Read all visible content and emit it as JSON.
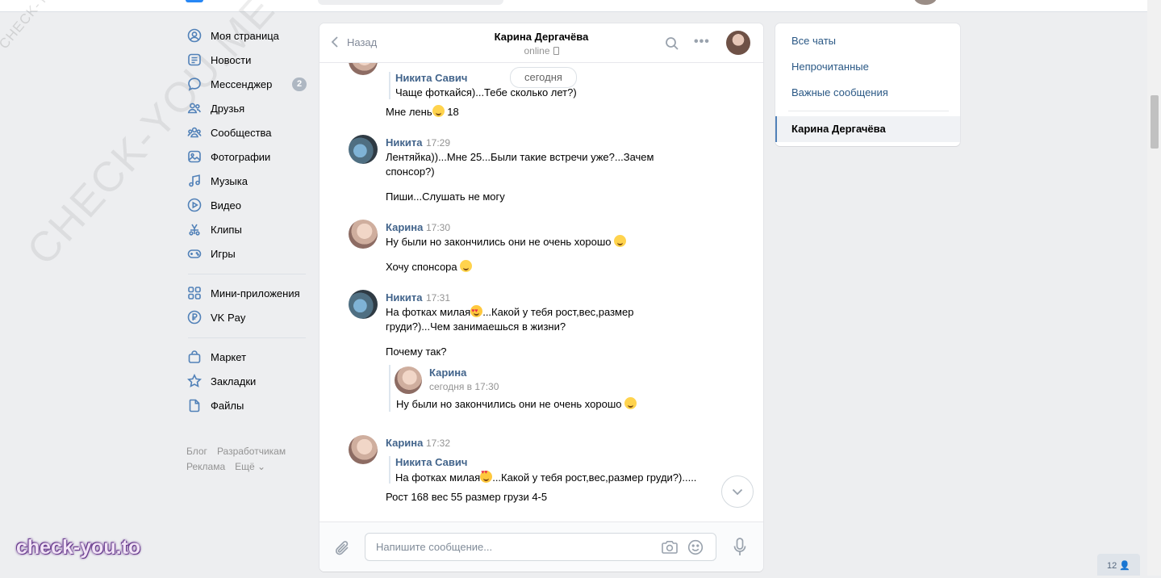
{
  "watermarks": {
    "diagonal_small": "CHECK-YOU.ME",
    "diagonal_large": "CHECK-YOU.ME",
    "corner": "check-you.to"
  },
  "leftnav": {
    "items": [
      {
        "label": "Моя страница",
        "icon": "user-circle-icon"
      },
      {
        "label": "Новости",
        "icon": "news-icon"
      },
      {
        "label": "Мессенджер",
        "icon": "chat-bubble-icon",
        "badge": "2"
      },
      {
        "label": "Друзья",
        "icon": "friends-icon"
      },
      {
        "label": "Сообщества",
        "icon": "communities-icon"
      },
      {
        "label": "Фотографии",
        "icon": "photos-icon"
      },
      {
        "label": "Музыка",
        "icon": "music-note-icon"
      },
      {
        "label": "Видео",
        "icon": "video-play-icon"
      },
      {
        "label": "Клипы",
        "icon": "clips-icon"
      },
      {
        "label": "Игры",
        "icon": "gamepad-icon"
      },
      {
        "label": "Мини-приложения",
        "icon": "grid-apps-icon"
      },
      {
        "label": "VK Pay",
        "icon": "ruble-coin-icon"
      },
      {
        "label": "Маркет",
        "icon": "shopping-bag-icon"
      },
      {
        "label": "Закладки",
        "icon": "star-icon"
      },
      {
        "label": "Файлы",
        "icon": "file-icon"
      }
    ],
    "footer": {
      "blog": "Блог",
      "developers": "Разработчикам",
      "ads": "Реклама",
      "more": "Ещё ⌄"
    }
  },
  "chat": {
    "back_label": "Назад",
    "peer_name": "Карина Дергачёва",
    "peer_status": "online",
    "date_pill": "сегодня",
    "messages": {
      "m0": {
        "fwd_name": "Никита Савич",
        "fwd_text": "Чаще фоткайся)...Тебе сколько лет?)",
        "text_a": "Мне лень",
        "text_b": " 18"
      },
      "m1": {
        "author": "Никита",
        "time": "17:29",
        "text_1": "Лентяйка))...Мне 25...Были такие встречи уже?...Зачем спонсор?)",
        "text_2": "Пиши...Слушать не могу"
      },
      "m2": {
        "author": "Карина",
        "time": "17:30",
        "text_1": "Ну были но закончились они не очень хорошо ",
        "text_2": "Хочу спонсора "
      },
      "m3": {
        "author": "Никита",
        "time": "17:31",
        "text_1a": "На фотках милая",
        "text_1b": "...Какой у тебя рост,вес,размер груди?)...Чем занимаешься в жизни?",
        "text_2": "Почему так?",
        "fwd_name": "Карина",
        "fwd_sub": "сегодня в 17:30",
        "fwd_text": "Ну были но закончились они не очень хорошо "
      },
      "m4": {
        "author": "Карина",
        "time": "17:32",
        "fwd_name": "Никита Савич",
        "fwd_text_a": "На фотках милая",
        "fwd_text_b": "...Какой у тебя рост,вес,размер груди?).....",
        "text_1": "Рост 168 вес 55 размер грузи 4-5"
      }
    },
    "composer": {
      "placeholder": "Напишите сообщение..."
    }
  },
  "rightpanel": {
    "all_chats": "Все чаты",
    "unread": "Непрочитанные",
    "important": "Важные сообщения",
    "active_chat": "Карина Дергачёва"
  },
  "online_counter": "12"
}
